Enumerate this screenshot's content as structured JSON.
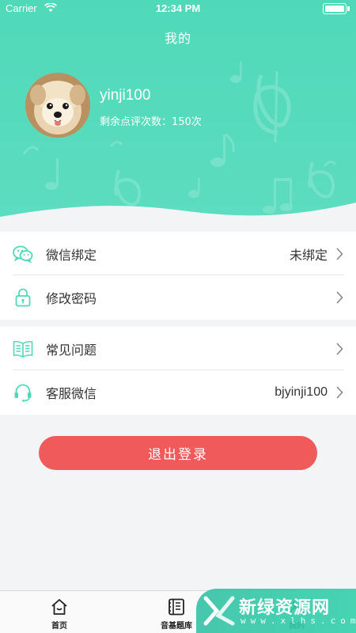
{
  "status_bar": {
    "carrier": "Carrier",
    "time": "12:34 PM"
  },
  "header": {
    "title": "我的"
  },
  "profile": {
    "username": "yinji100",
    "remaining": "剩余点评次数：150次"
  },
  "menu_groups": [
    [
      {
        "label": "微信绑定",
        "value": "未绑定",
        "icon": "wechat-icon"
      },
      {
        "label": "修改密码",
        "value": "",
        "icon": "lock-icon"
      }
    ],
    [
      {
        "label": "常见问题",
        "value": "",
        "icon": "book-icon"
      },
      {
        "label": "客服微信",
        "value": "bjyinji100",
        "icon": "headset-icon"
      }
    ]
  ],
  "logout_label": "退出登录",
  "tabs": [
    {
      "label": "首页",
      "icon": "home-icon"
    },
    {
      "label": "音基题库",
      "icon": "library-icon"
    },
    {
      "label": "我的",
      "icon": "profile-icon",
      "active": true
    }
  ],
  "watermark": {
    "name": "新绿资源网",
    "url": "www.xlhs.com"
  },
  "colors": {
    "accent": "#4fd9b9",
    "logout": "#f15a5a",
    "icon": "#4fd9b9"
  }
}
